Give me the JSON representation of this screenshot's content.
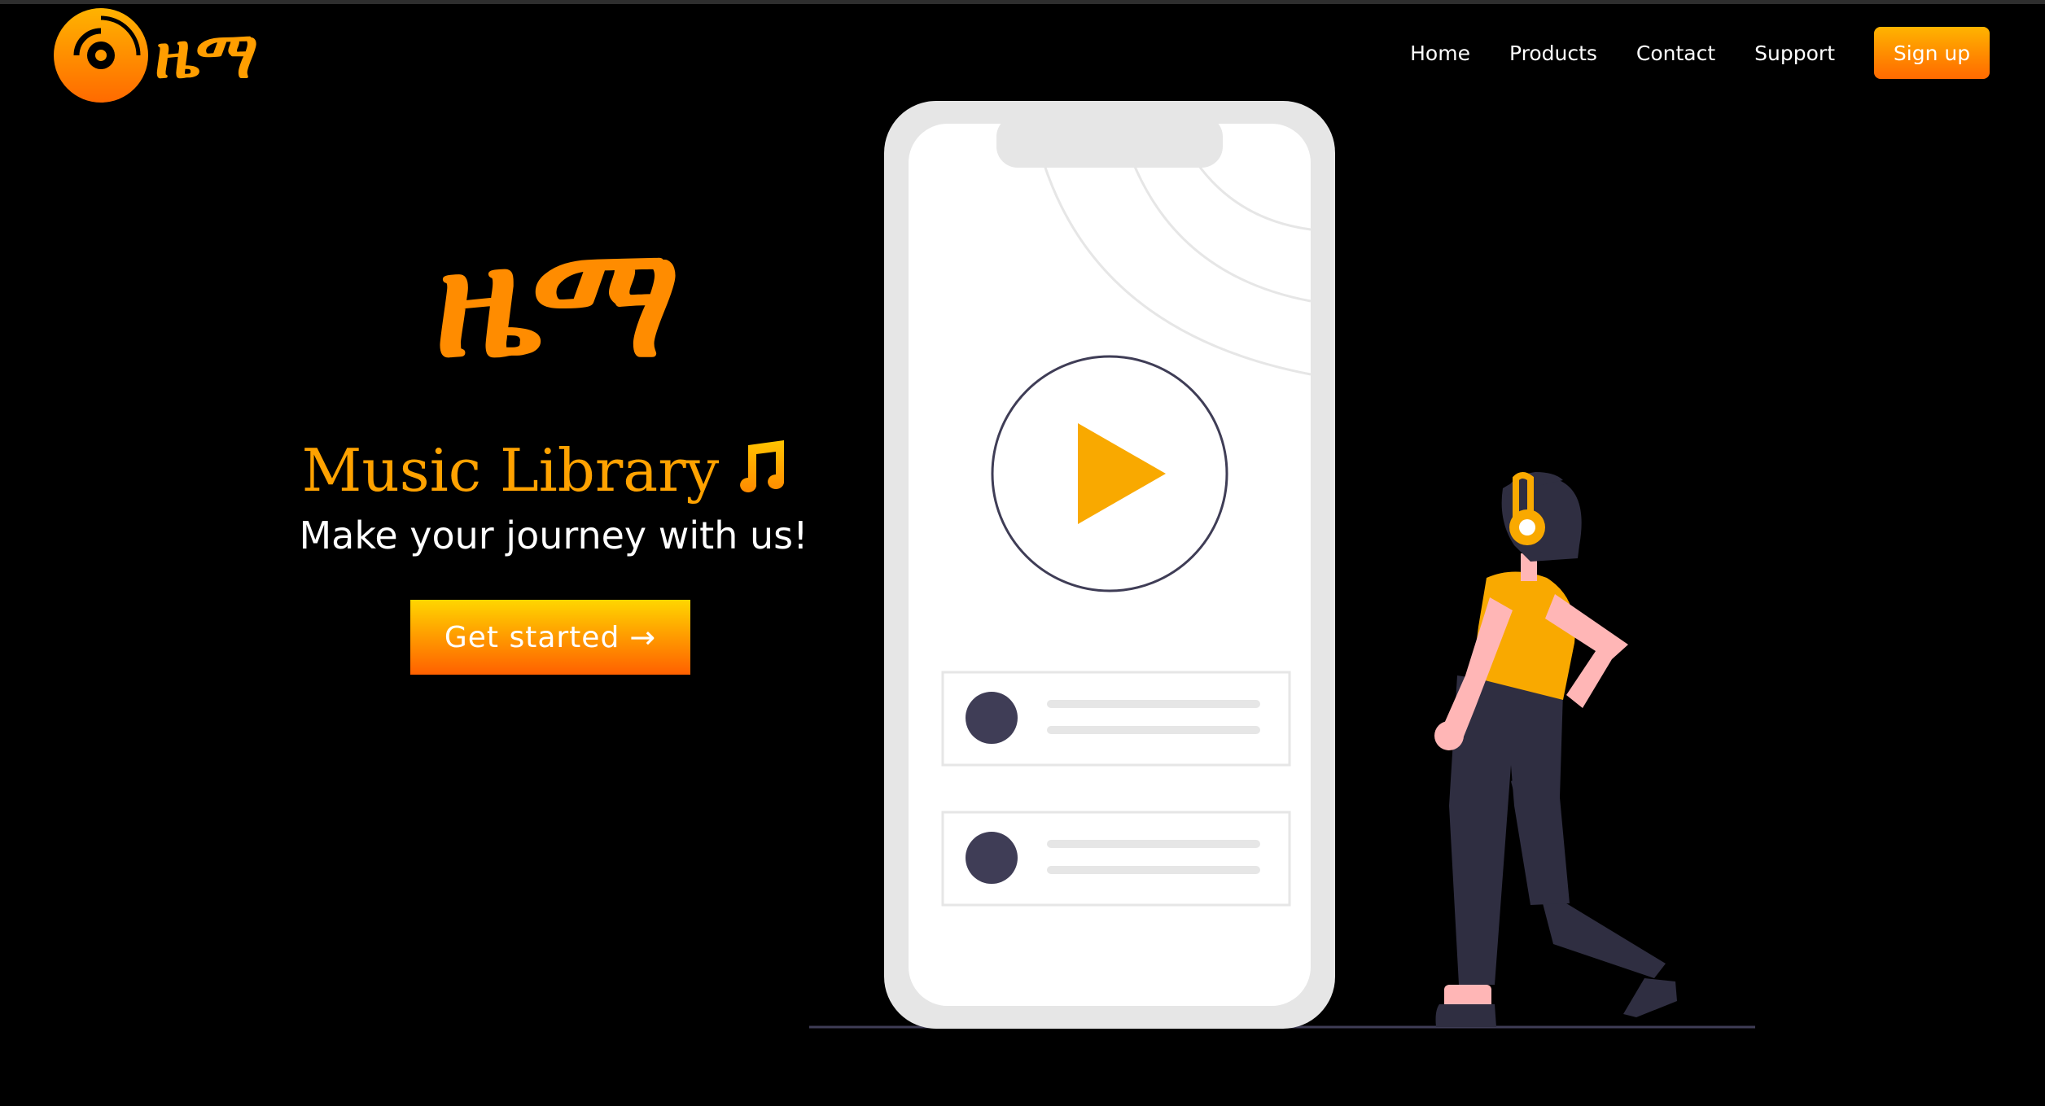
{
  "brand": {
    "logo_text": "ዜማ"
  },
  "nav": {
    "items": [
      "Home",
      "Products",
      "Contact",
      "Support"
    ],
    "signup_label": "Sign up"
  },
  "hero": {
    "title": "ዜማ",
    "subtitle": "Music Library",
    "tagline": "Make your journey with us!",
    "cta_label": "Get started",
    "cta_icon": "arrow-right-icon",
    "note_icon": "music-note-icon"
  },
  "colors": {
    "accent": "#ff8c00",
    "accent_light": "#ffb400",
    "background": "#000000",
    "phone_frame": "#e6e6e6",
    "figure_dark": "#2f2e41",
    "figure_yellow": "#f9a900",
    "skin": "#ffb6b6"
  }
}
